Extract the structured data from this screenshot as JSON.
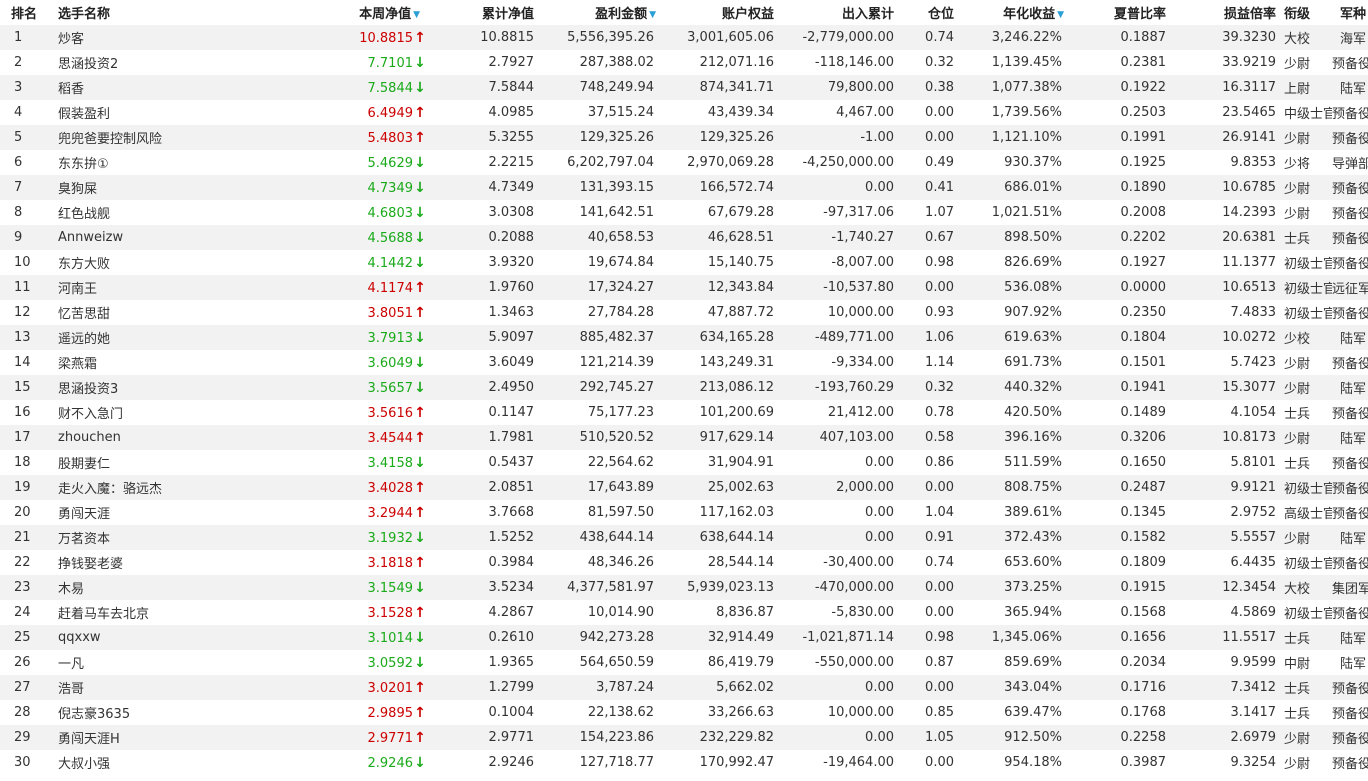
{
  "headers": {
    "rank": "排名",
    "name": "选手名称",
    "week_nav": "本周净值",
    "cum_nav": "累计净值",
    "profit": "盈利金额",
    "equity": "账户权益",
    "flow": "出入累计",
    "position": "仓位",
    "annual": "年化收益",
    "sharpe": "夏普比率",
    "pl_ratio": "损益倍率",
    "rank_title": "衔级",
    "branch": "军种"
  },
  "colors": {
    "up": "#cc0000",
    "down": "#1aaa1a",
    "sort": "#2a9fd6",
    "stripe": "#f2f2f2"
  },
  "icons": {
    "sort": "triangle-down-icon",
    "up": "arrow-up-icon",
    "down": "arrow-down-icon"
  },
  "rows": [
    {
      "rank": "1",
      "name": "炒客",
      "nav": "10.8815",
      "dir": "up",
      "cum": "10.8815",
      "profit": "5,556,395.26",
      "equity": "3,001,605.06",
      "flow": "-2,779,000.00",
      "pos": "0.74",
      "annual": "3,246.22%",
      "sharpe": "0.1887",
      "pl": "39.3230",
      "title": "大校",
      "branch": "海军"
    },
    {
      "rank": "2",
      "name": "思涵投资2",
      "nav": "7.7101",
      "dir": "down",
      "cum": "2.7927",
      "profit": "287,388.02",
      "equity": "212,071.16",
      "flow": "-118,146.00",
      "pos": "0.32",
      "annual": "1,139.45%",
      "sharpe": "0.2381",
      "pl": "33.9219",
      "title": "少尉",
      "branch": "预备役"
    },
    {
      "rank": "3",
      "name": "稻香",
      "nav": "7.5844",
      "dir": "down",
      "cum": "7.5844",
      "profit": "748,249.94",
      "equity": "874,341.71",
      "flow": "79,800.00",
      "pos": "0.38",
      "annual": "1,077.38%",
      "sharpe": "0.1922",
      "pl": "16.3117",
      "title": "上尉",
      "branch": "陆军"
    },
    {
      "rank": "4",
      "name": "假装盈利",
      "nav": "6.4949",
      "dir": "up",
      "cum": "4.0985",
      "profit": "37,515.24",
      "equity": "43,439.34",
      "flow": "4,467.00",
      "pos": "0.00",
      "annual": "1,739.56%",
      "sharpe": "0.2503",
      "pl": "23.5465",
      "title": "中级士官",
      "branch": "预备役"
    },
    {
      "rank": "5",
      "name": "兜兜爸要控制风险",
      "nav": "5.4803",
      "dir": "up",
      "cum": "5.3255",
      "profit": "129,325.26",
      "equity": "129,325.26",
      "flow": "-1.00",
      "pos": "0.00",
      "annual": "1,121.10%",
      "sharpe": "0.1991",
      "pl": "26.9141",
      "title": "少尉",
      "branch": "预备役"
    },
    {
      "rank": "6",
      "name": "东东拚①",
      "nav": "5.4629",
      "dir": "down",
      "cum": "2.2215",
      "profit": "6,202,797.04",
      "equity": "2,970,069.28",
      "flow": "-4,250,000.00",
      "pos": "0.49",
      "annual": "930.37%",
      "sharpe": "0.1925",
      "pl": "9.8353",
      "title": "少将",
      "branch": "导弹部队"
    },
    {
      "rank": "7",
      "name": "臭狗屎",
      "nav": "4.7349",
      "dir": "down",
      "cum": "4.7349",
      "profit": "131,393.15",
      "equity": "166,572.74",
      "flow": "0.00",
      "pos": "0.41",
      "annual": "686.01%",
      "sharpe": "0.1890",
      "pl": "10.6785",
      "title": "少尉",
      "branch": "预备役"
    },
    {
      "rank": "8",
      "name": "红色战舰",
      "nav": "4.6803",
      "dir": "down",
      "cum": "3.0308",
      "profit": "141,642.51",
      "equity": "67,679.28",
      "flow": "-97,317.06",
      "pos": "1.07",
      "annual": "1,021.51%",
      "sharpe": "0.2008",
      "pl": "14.2393",
      "title": "少尉",
      "branch": "预备役"
    },
    {
      "rank": "9",
      "name": "Annweizw",
      "nav": "4.5688",
      "dir": "down",
      "cum": "0.2088",
      "profit": "40,658.53",
      "equity": "46,628.51",
      "flow": "-1,740.27",
      "pos": "0.67",
      "annual": "898.50%",
      "sharpe": "0.2202",
      "pl": "20.6381",
      "title": "士兵",
      "branch": "预备役"
    },
    {
      "rank": "10",
      "name": "东方大败",
      "nav": "4.1442",
      "dir": "down",
      "cum": "3.9320",
      "profit": "19,674.84",
      "equity": "15,140.75",
      "flow": "-8,007.00",
      "pos": "0.98",
      "annual": "826.69%",
      "sharpe": "0.1927",
      "pl": "11.1377",
      "title": "初级士官",
      "branch": "预备役"
    },
    {
      "rank": "11",
      "name": "河南王",
      "nav": "4.1174",
      "dir": "up",
      "cum": "1.9760",
      "profit": "17,324.27",
      "equity": "12,343.84",
      "flow": "-10,537.80",
      "pos": "0.00",
      "annual": "536.08%",
      "sharpe": "0.0000",
      "pl": "10.6513",
      "title": "初级士官",
      "branch": "远征军"
    },
    {
      "rank": "12",
      "name": "忆苦思甜",
      "nav": "3.8051",
      "dir": "up",
      "cum": "1.3463",
      "profit": "27,784.28",
      "equity": "47,887.72",
      "flow": "10,000.00",
      "pos": "0.93",
      "annual": "907.92%",
      "sharpe": "0.2350",
      "pl": "7.4833",
      "title": "初级士官",
      "branch": "预备役"
    },
    {
      "rank": "13",
      "name": "遥远的她",
      "nav": "3.7913",
      "dir": "down",
      "cum": "5.9097",
      "profit": "885,482.37",
      "equity": "634,165.28",
      "flow": "-489,771.00",
      "pos": "1.06",
      "annual": "619.63%",
      "sharpe": "0.1804",
      "pl": "10.0272",
      "title": "少校",
      "branch": "陆军"
    },
    {
      "rank": "14",
      "name": "梁燕霜",
      "nav": "3.6049",
      "dir": "down",
      "cum": "3.6049",
      "profit": "121,214.39",
      "equity": "143,249.31",
      "flow": "-9,334.00",
      "pos": "1.14",
      "annual": "691.73%",
      "sharpe": "0.1501",
      "pl": "5.7423",
      "title": "少尉",
      "branch": "预备役"
    },
    {
      "rank": "15",
      "name": "思涵投资3",
      "nav": "3.5657",
      "dir": "down",
      "cum": "2.4950",
      "profit": "292,745.27",
      "equity": "213,086.12",
      "flow": "-193,760.29",
      "pos": "0.32",
      "annual": "440.32%",
      "sharpe": "0.1941",
      "pl": "15.3077",
      "title": "少尉",
      "branch": "陆军"
    },
    {
      "rank": "16",
      "name": "财不入急门",
      "nav": "3.5616",
      "dir": "up",
      "cum": "0.1147",
      "profit": "75,177.23",
      "equity": "101,200.69",
      "flow": "21,412.00",
      "pos": "0.78",
      "annual": "420.50%",
      "sharpe": "0.1489",
      "pl": "4.1054",
      "title": "士兵",
      "branch": "预备役"
    },
    {
      "rank": "17",
      "name": "zhouchen",
      "nav": "3.4544",
      "dir": "up",
      "cum": "1.7981",
      "profit": "510,520.52",
      "equity": "917,629.14",
      "flow": "407,103.00",
      "pos": "0.58",
      "annual": "396.16%",
      "sharpe": "0.3206",
      "pl": "10.8173",
      "title": "少尉",
      "branch": "陆军"
    },
    {
      "rank": "18",
      "name": "股期妻仁",
      "nav": "3.4158",
      "dir": "down",
      "cum": "0.5437",
      "profit": "22,564.62",
      "equity": "31,904.91",
      "flow": "0.00",
      "pos": "0.86",
      "annual": "511.59%",
      "sharpe": "0.1650",
      "pl": "5.8101",
      "title": "士兵",
      "branch": "预备役"
    },
    {
      "rank": "19",
      "name": "走火入魔：骆远杰",
      "nav": "3.4028",
      "dir": "up",
      "cum": "2.0851",
      "profit": "17,643.89",
      "equity": "25,002.63",
      "flow": "2,000.00",
      "pos": "0.00",
      "annual": "808.75%",
      "sharpe": "0.2487",
      "pl": "9.9121",
      "title": "初级士官",
      "branch": "预备役"
    },
    {
      "rank": "20",
      "name": "勇闯天涯",
      "nav": "3.2944",
      "dir": "up",
      "cum": "3.7668",
      "profit": "81,597.50",
      "equity": "117,162.03",
      "flow": "0.00",
      "pos": "1.04",
      "annual": "389.61%",
      "sharpe": "0.1345",
      "pl": "2.9752",
      "title": "高级士官",
      "branch": "预备役"
    },
    {
      "rank": "21",
      "name": "万茗资本",
      "nav": "3.1932",
      "dir": "down",
      "cum": "1.5252",
      "profit": "438,644.14",
      "equity": "638,644.14",
      "flow": "0.00",
      "pos": "0.91",
      "annual": "372.43%",
      "sharpe": "0.1582",
      "pl": "5.5557",
      "title": "少尉",
      "branch": "陆军"
    },
    {
      "rank": "22",
      "name": "挣钱娶老婆",
      "nav": "3.1818",
      "dir": "up",
      "cum": "0.3984",
      "profit": "48,346.26",
      "equity": "28,544.14",
      "flow": "-30,400.00",
      "pos": "0.74",
      "annual": "653.60%",
      "sharpe": "0.1809",
      "pl": "6.4435",
      "title": "初级士官",
      "branch": "预备役"
    },
    {
      "rank": "23",
      "name": "木易",
      "nav": "3.1549",
      "dir": "down",
      "cum": "3.5234",
      "profit": "4,377,581.97",
      "equity": "5,939,023.13",
      "flow": "-470,000.00",
      "pos": "0.00",
      "annual": "373.25%",
      "sharpe": "0.1915",
      "pl": "12.3454",
      "title": "大校",
      "branch": "集团军"
    },
    {
      "rank": "24",
      "name": "赶着马车去北京",
      "nav": "3.1528",
      "dir": "up",
      "cum": "4.2867",
      "profit": "10,014.90",
      "equity": "8,836.87",
      "flow": "-5,830.00",
      "pos": "0.00",
      "annual": "365.94%",
      "sharpe": "0.1568",
      "pl": "4.5869",
      "title": "初级士官",
      "branch": "预备役"
    },
    {
      "rank": "25",
      "name": "qqxxw",
      "nav": "3.1014",
      "dir": "down",
      "cum": "0.2610",
      "profit": "942,273.28",
      "equity": "32,914.49",
      "flow": "-1,021,871.14",
      "pos": "0.98",
      "annual": "1,345.06%",
      "sharpe": "0.1656",
      "pl": "11.5517",
      "title": "士兵",
      "branch": "陆军"
    },
    {
      "rank": "26",
      "name": "一凡",
      "nav": "3.0592",
      "dir": "down",
      "cum": "1.9365",
      "profit": "564,650.59",
      "equity": "86,419.79",
      "flow": "-550,000.00",
      "pos": "0.87",
      "annual": "859.69%",
      "sharpe": "0.2034",
      "pl": "9.9599",
      "title": "中尉",
      "branch": "陆军"
    },
    {
      "rank": "27",
      "name": "浩哥",
      "nav": "3.0201",
      "dir": "up",
      "cum": "1.2799",
      "profit": "3,787.24",
      "equity": "5,662.02",
      "flow": "0.00",
      "pos": "0.00",
      "annual": "343.04%",
      "sharpe": "0.1716",
      "pl": "7.3412",
      "title": "士兵",
      "branch": "预备役"
    },
    {
      "rank": "28",
      "name": "倪志豪3635",
      "nav": "2.9895",
      "dir": "up",
      "cum": "0.1004",
      "profit": "22,138.62",
      "equity": "33,266.63",
      "flow": "10,000.00",
      "pos": "0.85",
      "annual": "639.47%",
      "sharpe": "0.1768",
      "pl": "3.1417",
      "title": "士兵",
      "branch": "预备役"
    },
    {
      "rank": "29",
      "name": "勇闯天涯H",
      "nav": "2.9771",
      "dir": "up",
      "cum": "2.9771",
      "profit": "154,223.86",
      "equity": "232,229.82",
      "flow": "0.00",
      "pos": "1.05",
      "annual": "912.50%",
      "sharpe": "0.2258",
      "pl": "2.6979",
      "title": "少尉",
      "branch": "预备役"
    },
    {
      "rank": "30",
      "name": "大叔小强",
      "nav": "2.9246",
      "dir": "down",
      "cum": "2.9246",
      "profit": "127,718.77",
      "equity": "170,992.47",
      "flow": "-19,464.00",
      "pos": "0.00",
      "annual": "954.18%",
      "sharpe": "0.3987",
      "pl": "9.3254",
      "title": "少尉",
      "branch": "预备役"
    }
  ]
}
